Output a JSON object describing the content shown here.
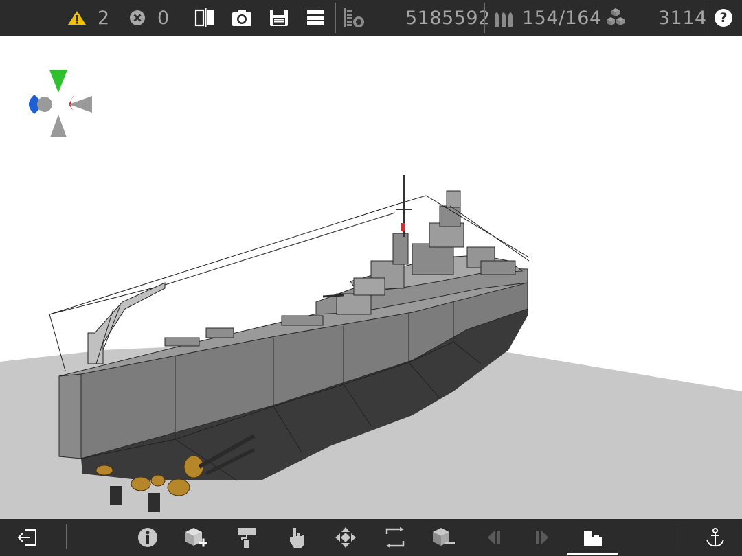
{
  "toolbar": {
    "warnings_count": "2",
    "errors_count": "0",
    "weight_value": "5185592",
    "ammo_value": "154/164",
    "blocks_value": "3114",
    "help_label": "?"
  },
  "icons": {
    "warning": "warning-icon",
    "error": "error-icon",
    "mirror": "mirror-icon",
    "camera": "camera-icon",
    "save": "save-icon",
    "menu": "menu-icon",
    "weight": "weight-icon",
    "ammo": "ammo-icon",
    "blocks": "blocks-icon",
    "help": "help-icon"
  },
  "bottom_tools": [
    "exit-icon",
    "info-icon",
    "add-block-icon",
    "paint-roller-icon",
    "hand-pointer-icon",
    "move-icon",
    "resize-icon",
    "remove-block-icon",
    "step-back-icon",
    "step-forward-icon",
    "build-mode-icon",
    "anchor-icon"
  ],
  "colors": {
    "bar_bg": "#2b2b2b",
    "warning_yellow": "#f2c200",
    "axis_green": "#2fbf2f",
    "axis_red": "#d42020",
    "axis_blue": "#1f5fd6",
    "axis_gray": "#9a9a9a",
    "hull_gray": "#7a7a7a",
    "hull_dark": "#3a3a3a",
    "ground_gray": "#c8c8c8"
  }
}
